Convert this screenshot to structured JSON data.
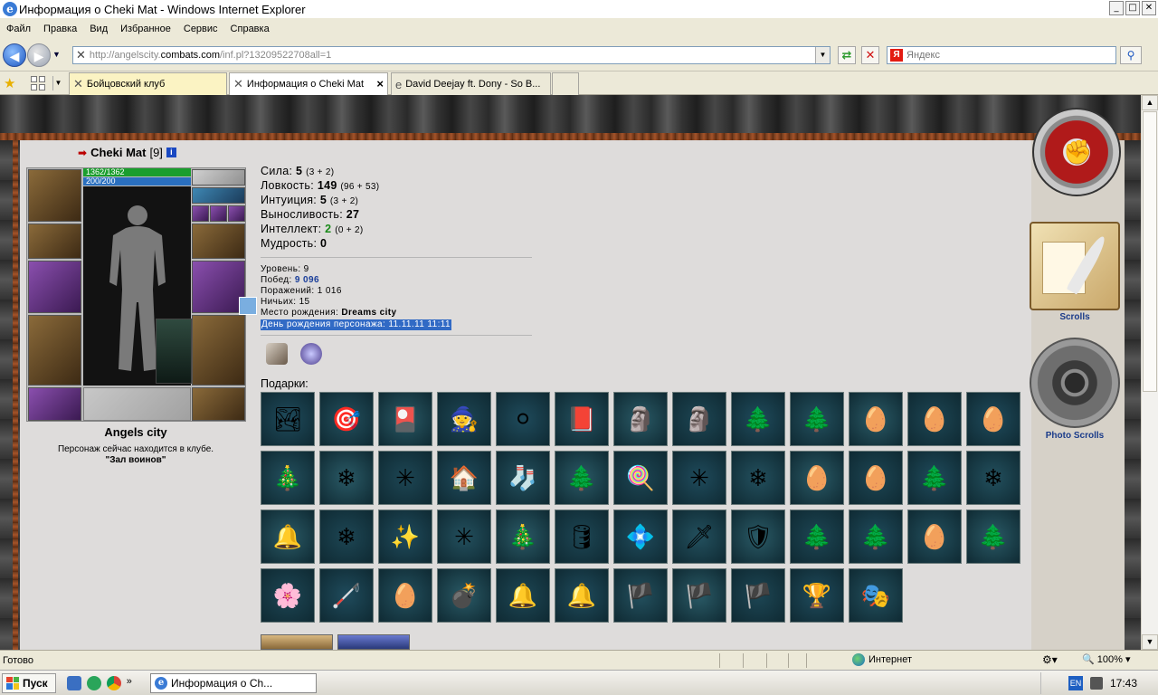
{
  "window": {
    "title": "Информация о Cheki Mat - Windows Internet Explorer",
    "min": "_",
    "max": "□",
    "close": "✕"
  },
  "menu": [
    "Файл",
    "Правка",
    "Вид",
    "Избранное",
    "Сервис",
    "Справка"
  ],
  "address": {
    "prefix": "http://angelscity.",
    "host": "combats.com",
    "path": "/inf.pl?13209522708all=1"
  },
  "search": {
    "placeholder": "Яндекс",
    "engine_letter": "Я"
  },
  "tabs": [
    {
      "label": "Бойцовский клуб"
    },
    {
      "label": "Информация о Cheki Mat"
    },
    {
      "label": "David Deejay ft. Dony - So B..."
    }
  ],
  "character": {
    "name": "Cheki Mat",
    "level": "[9]",
    "hp": "1362/1362",
    "mana": "200/200",
    "city": "Angels city",
    "status": "Персонаж сейчас находится в клубе.",
    "location": "\"Зал воинов\""
  },
  "stats": [
    {
      "label": "Сила:",
      "value": "5",
      "extra": "(3 + 2)"
    },
    {
      "label": "Ловкость:",
      "value": "149",
      "extra": "(96 + 53)"
    },
    {
      "label": "Интуиция:",
      "value": "5",
      "extra": "(3 + 2)"
    },
    {
      "label": "Выносливость:",
      "value": "27",
      "extra": ""
    },
    {
      "label": "Интеллект:",
      "value": "2",
      "extra": "(0 + 2)"
    },
    {
      "label": "Мудрость:",
      "value": "0",
      "extra": ""
    }
  ],
  "info": {
    "level": "Уровень: 9",
    "wins_label": "Побед: ",
    "wins": "9 096",
    "losses": "Поражений: 1 016",
    "draws": "Ничьих: 15",
    "birthplace_label": "Место рождения: ",
    "birthplace": "Dreams city",
    "birthday": "День рождения персонажа: 11.11.11 11:11"
  },
  "gifts_label": "Подарки:",
  "gifts": [
    "🏞",
    "🎯",
    "🎴",
    "🧙",
    "⚪",
    "📕",
    "🗿",
    "🗿",
    "🌲",
    "🌲",
    "🥚",
    "🥚",
    "🥚",
    "🎄",
    "❄",
    "✳",
    "🏠",
    "🧦",
    "🌲",
    "🍭",
    "✳",
    "❄",
    "🥚",
    "🥚",
    "🌲",
    "❄",
    "🔔",
    "❄",
    "✨",
    "✳",
    "🎄",
    "🛢",
    "💠",
    "🗡",
    "🛡",
    "🌲",
    "🌲",
    "🥚",
    "🌲",
    "🌸",
    "🦯",
    "🥚",
    "💣",
    "🔔",
    "🔔",
    "🏴",
    "🏴",
    "🏴",
    "🏆",
    "🎭"
  ],
  "right_panel": {
    "scrolls": "Scrolls",
    "photo_scrolls": "Photo Scrolls"
  },
  "statusbar": {
    "ready": "Готово",
    "zone": "Интернет",
    "zoom": "100%"
  },
  "taskbar": {
    "start": "Пуск",
    "task": "Информация о Ch...",
    "lang": "EN",
    "clock": "17:43"
  }
}
